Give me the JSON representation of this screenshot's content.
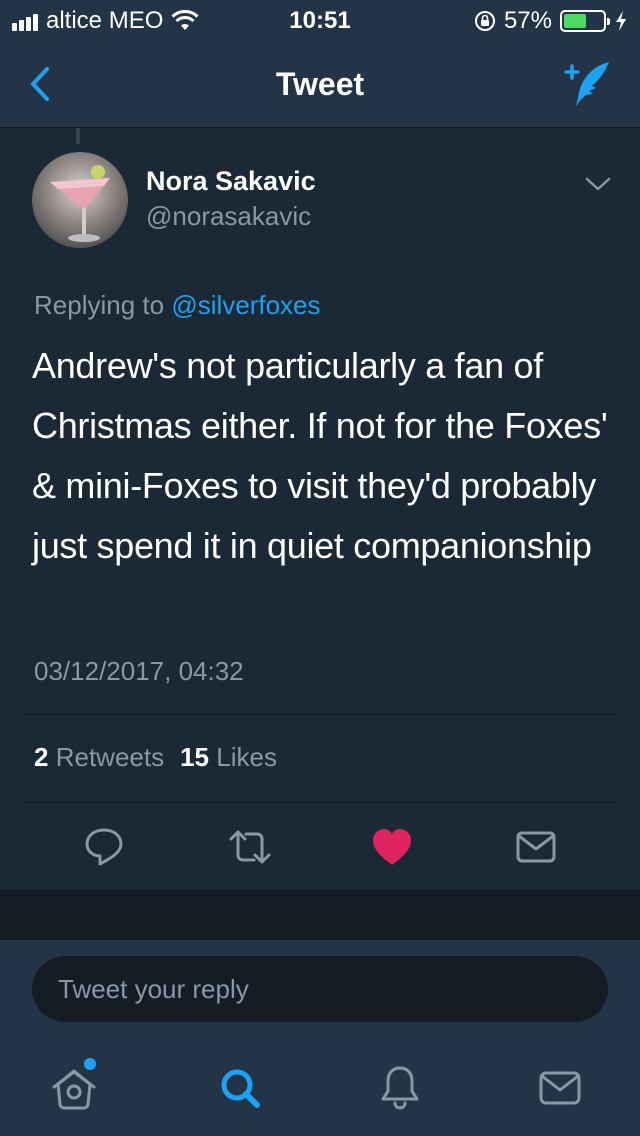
{
  "status_bar": {
    "carrier": "altice MEO",
    "time": "10:51",
    "battery_percent": "57%",
    "battery_level": 0.57
  },
  "nav": {
    "title": "Tweet",
    "back_icon": "chevron-left-icon",
    "compose_icon": "compose-tweet-icon"
  },
  "tweet": {
    "author_name": "Nora Sakavic",
    "author_handle": "@norasakavic",
    "replying_prefix": "Replying to ",
    "replying_to": "@silverfoxes",
    "text": "Andrew's not particularly a fan of Christmas either. If not for the Foxes' & mini-Foxes to visit they'd probably just spend it in quiet companionship",
    "timestamp": "03/12/2017, 04:32",
    "retweets_count": "2",
    "retweets_label": "Retweets",
    "likes_count": "15",
    "likes_label": "Likes",
    "liked": true
  },
  "actions": [
    {
      "name": "reply-icon"
    },
    {
      "name": "retweet-icon"
    },
    {
      "name": "like-icon"
    },
    {
      "name": "direct-message-icon"
    }
  ],
  "reply": {
    "placeholder": "Tweet your reply"
  },
  "tabs": [
    {
      "name": "home-icon",
      "has_notification_dot": true
    },
    {
      "name": "search-icon",
      "active": true
    },
    {
      "name": "notifications-icon"
    },
    {
      "name": "messages-icon"
    }
  ],
  "colors": {
    "background": "#1b2836",
    "bar": "#243447",
    "accent": "#1da1f2",
    "secondary_text": "#8899a6",
    "like": "#e0245e",
    "battery": "#4cd964"
  }
}
